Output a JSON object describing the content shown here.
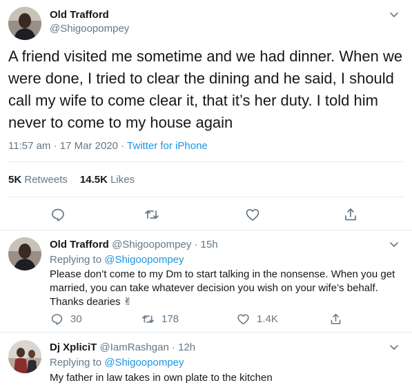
{
  "main_tweet": {
    "author_name": "Old Trafford",
    "handle": "@Shigoopompey",
    "text": "A friend visited me sometime and we had dinner. When we were done, I tried to clear the dining and he said, I should call my wife to come clear it, that it’s her duty. I told him never to come to my house again",
    "time": "11:57 am · 17 Mar 2020 · ",
    "source": "Twitter for iPhone",
    "retweets_count": "5K",
    "retweets_label": "Retweets",
    "likes_count": "14.5K",
    "likes_label": "Likes"
  },
  "replies": [
    {
      "author_name": "Old Trafford",
      "handle_time": "@Shigoopompey · 15h",
      "replying_label": "Replying to ",
      "replying_to": "@Shigoopompey",
      "text": "Please don’t come to my Dm to start talking in the nonsense. When you get married, you can take whatever decision you wish on your wife’s behalf. Thanks dearies ✌",
      "reply_count": "30",
      "retweet_count": "178",
      "like_count": "1.4K"
    },
    {
      "author_name": "Dj XpliciT",
      "handle_time": "@IamRashgan · 12h",
      "replying_label": "Replying to ",
      "replying_to": "@Shigoopompey",
      "text": "My father in law takes in own plate to the kitchen"
    }
  ],
  "icons": {
    "reply": "reply-icon",
    "retweet": "retweet-icon",
    "like": "heart-icon",
    "share": "share-icon",
    "more": "chevron-down-icon"
  },
  "colors": {
    "accent": "#1b95e0",
    "secondary_text": "#657786",
    "divider": "#e6ecf0"
  }
}
